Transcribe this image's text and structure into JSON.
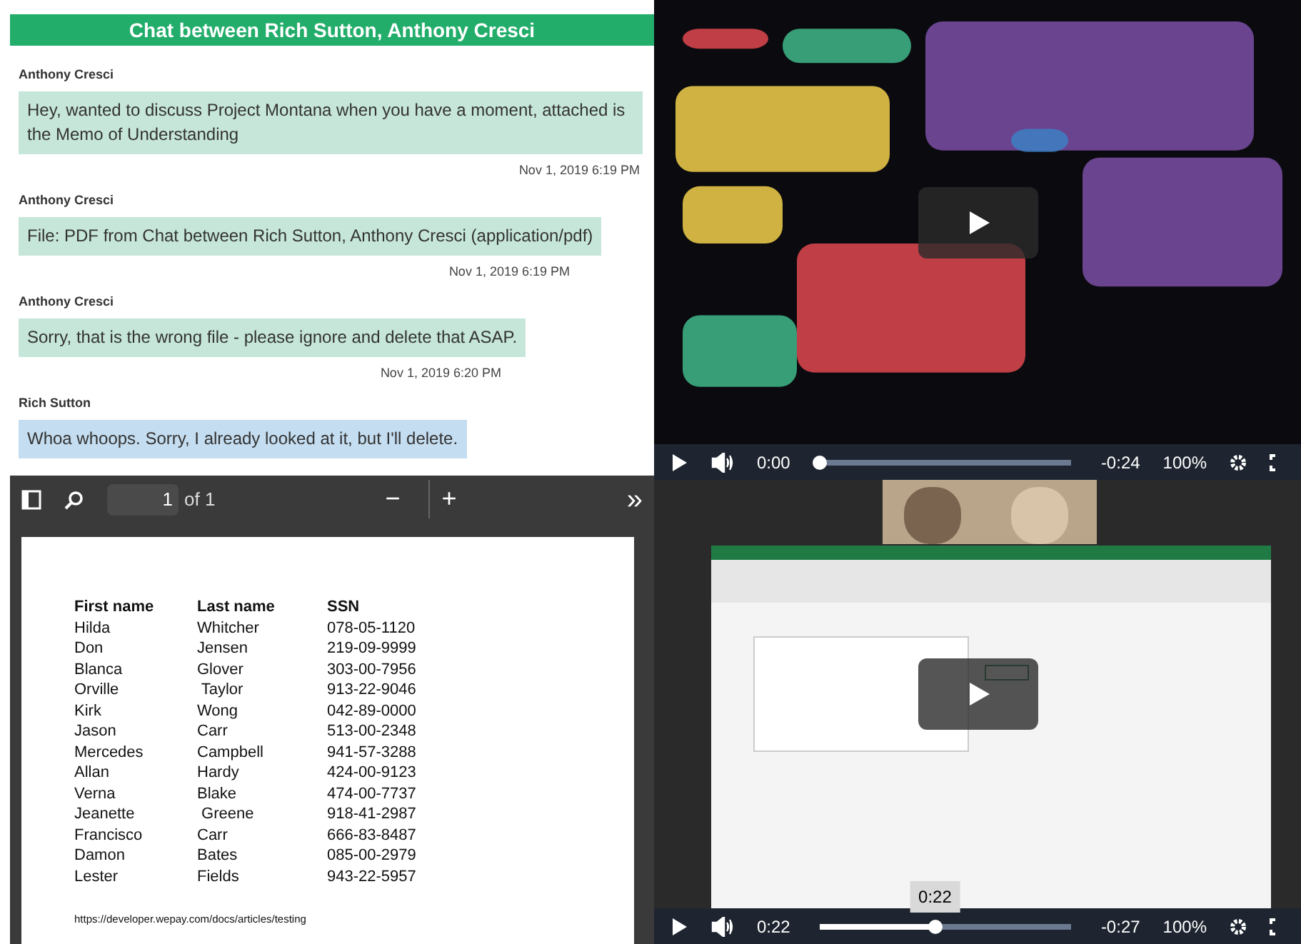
{
  "chat": {
    "title": "Chat between Rich Sutton, Anthony Cresci",
    "messages": [
      {
        "sender": "Anthony Cresci",
        "text": "Hey, wanted to discuss Project Montana when you have a moment, attached is the Memo of Understanding",
        "time": "Nov 1, 2019 6:19 PM",
        "kind": "incoming"
      },
      {
        "sender": "Anthony Cresci",
        "text": "File: PDF from Chat between Rich Sutton, Anthony Cresci (application/pdf)",
        "time": "Nov 1, 2019 6:19 PM",
        "kind": "incoming"
      },
      {
        "sender": "Anthony Cresci",
        "text": "Sorry, that is the wrong file - please ignore and delete that ASAP.",
        "time": "Nov 1, 2019 6:20 PM",
        "kind": "incoming"
      },
      {
        "sender": "Rich Sutton",
        "text": "Whoa whoops. Sorry, I already looked at it, but I'll delete.",
        "kind": "outgoing"
      }
    ]
  },
  "pdf_viewer": {
    "page": "1",
    "page_count": "of 1",
    "zoom_out": "−",
    "zoom_in": "+",
    "more": "»",
    "table": {
      "columns": [
        "First name",
        "Last name",
        "SSN"
      ],
      "rows": [
        [
          "Hilda",
          "Whitcher",
          "078-05-1120"
        ],
        [
          "Don",
          "Jensen",
          "219-09-9999"
        ],
        [
          "Blanca",
          "Glover",
          "303-00-7956"
        ],
        [
          "Orville",
          " Taylor",
          "913-22-9046"
        ],
        [
          "Kirk",
          "Wong",
          "042-89-0000"
        ],
        [
          "Jason",
          "Carr",
          "513-00-2348"
        ],
        [
          "Mercedes",
          "Campbell",
          "941-57-3288"
        ],
        [
          "Allan",
          "Hardy",
          "424-00-9123"
        ],
        [
          "Verna",
          "Blake",
          "474-00-7737"
        ],
        [
          "Jeanette",
          " Greene",
          "918-41-2987"
        ],
        [
          "Francisco",
          "Carr",
          "666-83-8487"
        ],
        [
          "Damon",
          "Bates",
          "085-00-2979"
        ],
        [
          "Lester",
          "Fields",
          "943-22-5957"
        ]
      ]
    },
    "link": "https://developer.wepay.com/docs/articles/testing"
  },
  "videos": [
    {
      "kind": "picture",
      "elapsed": "0:00",
      "remaining": "-0:24",
      "speed": "100%",
      "level": 0
    },
    {
      "kind": "picture",
      "elapsed": "0:22",
      "remaining": "-0:27",
      "speed": "100%",
      "level": 0.46,
      "tooltip": "0:22"
    }
  ]
}
